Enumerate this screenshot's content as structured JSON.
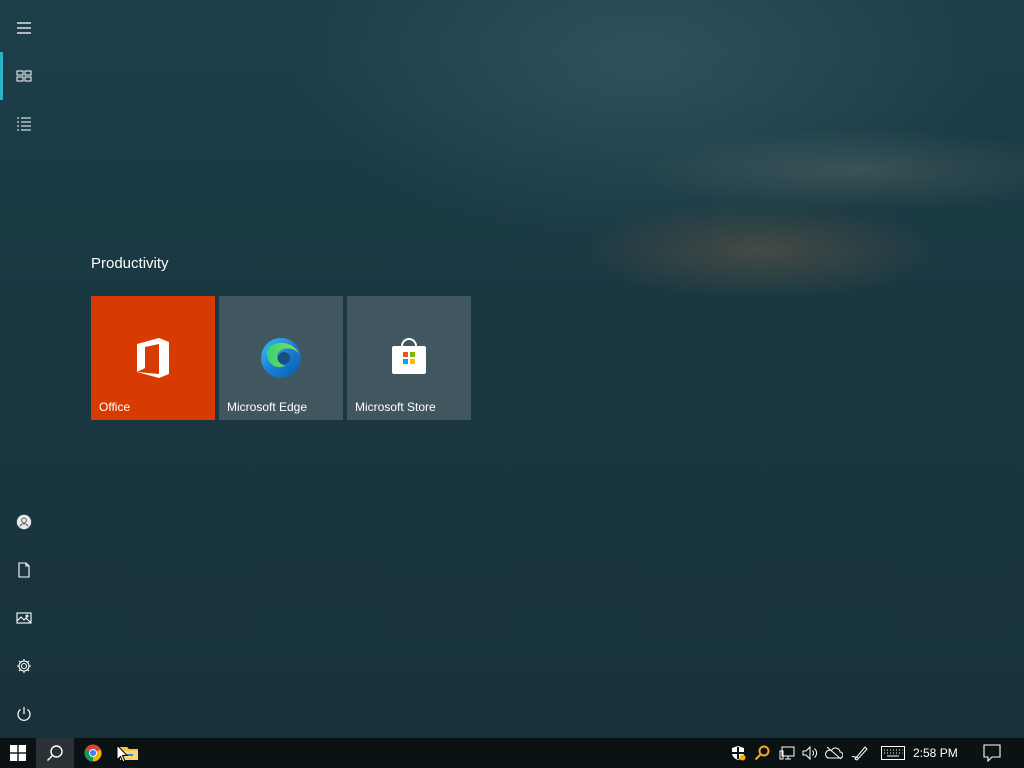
{
  "start_menu": {
    "group_title": "Productivity",
    "tiles": [
      {
        "label": "Office",
        "icon": "office-icon",
        "color": "#d83b01"
      },
      {
        "label": "Microsoft Edge",
        "icon": "edge-icon"
      },
      {
        "label": "Microsoft Store",
        "icon": "store-icon"
      }
    ],
    "rail": {
      "top": [
        "hamburger-menu-icon",
        "pinned-tiles-icon",
        "all-apps-list-icon"
      ],
      "bottom": [
        "user-icon",
        "documents-icon",
        "pictures-icon",
        "settings-icon",
        "power-icon"
      ]
    },
    "accent_color": "#2fb2c8"
  },
  "taskbar": {
    "pinned": [
      "start-icon",
      "search-icon",
      "chrome-icon",
      "file-explorer-icon"
    ],
    "tray": [
      "windows-security-icon",
      "search-tray-icon",
      "network-icon",
      "volume-icon",
      "onedrive-icon",
      "pen-icon",
      "touch-keyboard-icon",
      "action-center-icon"
    ],
    "time": "2:58 PM"
  }
}
